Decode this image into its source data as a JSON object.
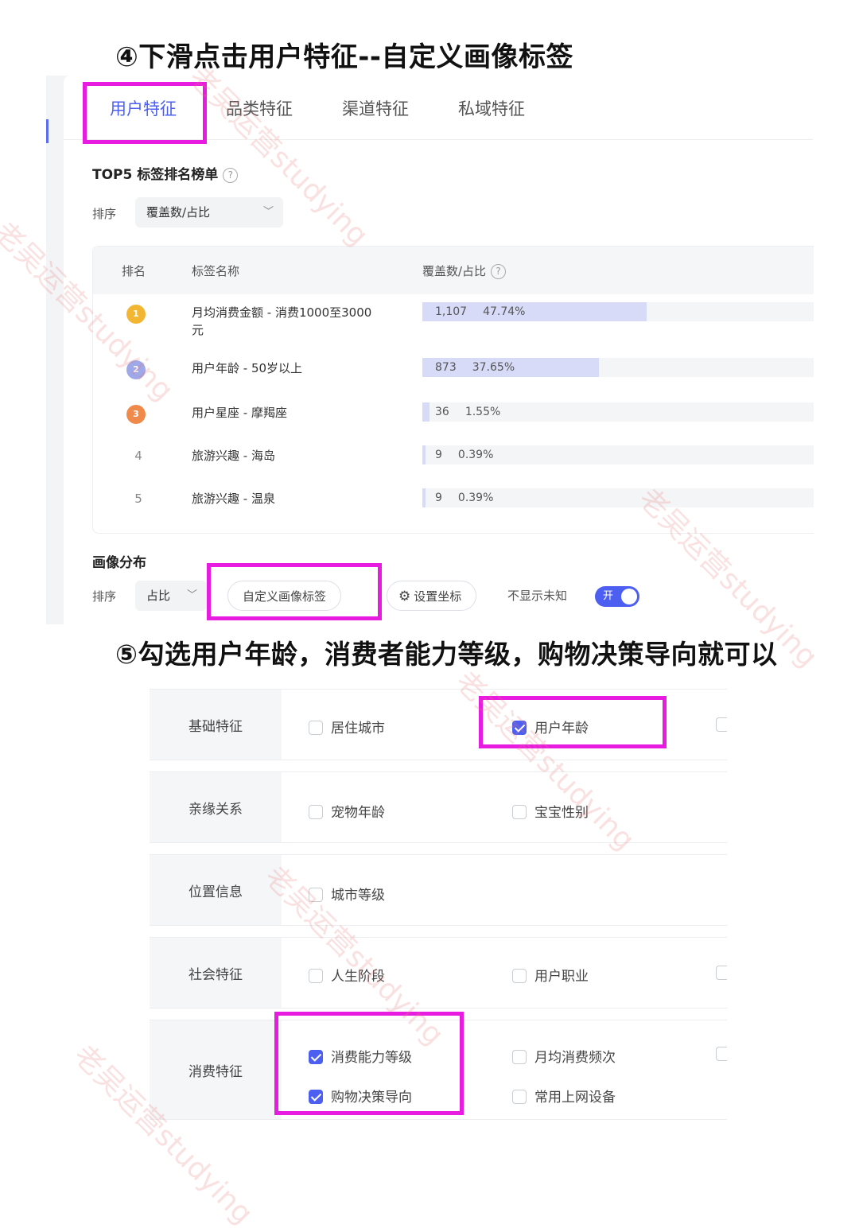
{
  "step4_title": "④下滑点击用户特征--自定义画像标签",
  "step5_title": "⑤勾选用户年龄，消费者能力等级，购物决策导向就可以",
  "tabs": [
    {
      "label": "用户特征",
      "active": true
    },
    {
      "label": "品类特征",
      "active": false
    },
    {
      "label": "渠道特征",
      "active": false
    },
    {
      "label": "私域特征",
      "active": false
    }
  ],
  "top5": {
    "title": "TOP5 标签排名榜单",
    "help_icon": "?",
    "sort_label": "排序",
    "sort_value": "覆盖数/占比",
    "headers": {
      "rank": "排名",
      "name": "标签名称",
      "coverage": "覆盖数/占比"
    },
    "rows": [
      {
        "rank": "1",
        "medal": "gold",
        "name": "月均消费金额 - 消费1000至3000元",
        "count": "1,107",
        "pct": "47.74%",
        "pct_value": 47.74
      },
      {
        "rank": "2",
        "medal": "silver",
        "name": "用户年龄 - 50岁以上",
        "count": "873",
        "pct": "37.65%",
        "pct_value": 37.65
      },
      {
        "rank": "3",
        "medal": "bronze",
        "name": "用户星座 - 摩羯座",
        "count": "36",
        "pct": "1.55%",
        "pct_value": 1.55
      },
      {
        "rank": "4",
        "medal": "",
        "name": "旅游兴趣 - 海岛",
        "count": "9",
        "pct": "0.39%",
        "pct_value": 0.39
      },
      {
        "rank": "5",
        "medal": "",
        "name": "旅游兴趣 - 温泉",
        "count": "9",
        "pct": "0.39%",
        "pct_value": 0.39
      }
    ]
  },
  "portrait": {
    "title": "画像分布",
    "sort_label": "排序",
    "sort_value": "占比",
    "custom_button": "自定义画像标签",
    "axis_button": "设置坐标",
    "hide_unknown_label": "不显示未知",
    "toggle_text": "开",
    "toggle_on": true
  },
  "feature_groups": [
    {
      "label": "基础特征",
      "options": [
        {
          "label": "居住城市",
          "checked": false
        },
        {
          "label": "用户年龄",
          "checked": true
        }
      ]
    },
    {
      "label": "亲缘关系",
      "options": [
        {
          "label": "宠物年龄",
          "checked": false
        },
        {
          "label": "宝宝性别",
          "checked": false
        }
      ]
    },
    {
      "label": "位置信息",
      "options": [
        {
          "label": "城市等级",
          "checked": false
        }
      ]
    },
    {
      "label": "社会特征",
      "options": [
        {
          "label": "人生阶段",
          "checked": false
        },
        {
          "label": "用户职业",
          "checked": false
        }
      ]
    },
    {
      "label": "消费特征",
      "options": [
        {
          "label": "消费能力等级",
          "checked": true
        },
        {
          "label": "月均消费频次",
          "checked": false
        },
        {
          "label": "购物决策导向",
          "checked": true
        },
        {
          "label": "常用上网设备",
          "checked": false
        }
      ]
    }
  ],
  "watermark": "老吴运营studying",
  "colors": {
    "accent": "#4c5ff0",
    "highlight": "#e81ce0"
  }
}
